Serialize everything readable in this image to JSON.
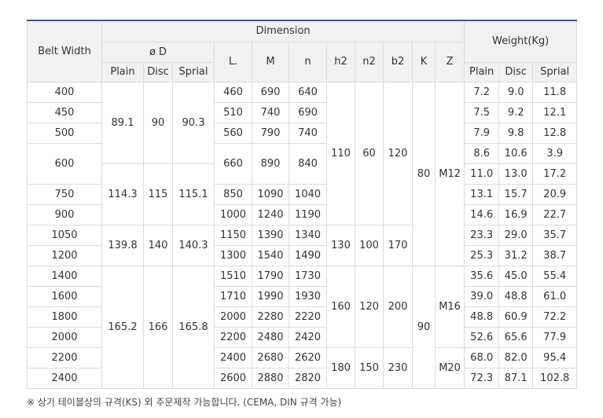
{
  "table": {
    "headers": {
      "belt_width": "Belt Width",
      "dimension": "Dimension",
      "weight": "Weight(Kg)",
      "phi_d": "ø D",
      "l": "L.",
      "m": "M",
      "n": "n",
      "h2": "h2",
      "n2": "n2",
      "b2": "b2",
      "k": "K",
      "z": "Z",
      "plain": "Plain",
      "disc": "Disc",
      "sprial": "Sprial",
      "w_plain": "Plain",
      "w_disc": "Disc",
      "w_sprial": "Sprial"
    },
    "belt_widths": [
      "400",
      "450",
      "500",
      "600",
      "750",
      "900",
      "1050",
      "1200",
      "1400",
      "1600",
      "1800",
      "2000",
      "2200",
      "2400"
    ],
    "phi_d_groups": [
      {
        "plain": "89.1",
        "disc": "90",
        "sprial": "90.3"
      },
      {
        "plain": "114.3",
        "disc": "115",
        "sprial": "115.1"
      },
      {
        "plain": "139.8",
        "disc": "140",
        "sprial": "140.3"
      },
      {
        "plain": "165.2",
        "disc": "166",
        "sprial": "165.8"
      }
    ],
    "lmn": [
      [
        "460",
        "690",
        "640"
      ],
      [
        "510",
        "740",
        "690"
      ],
      [
        "560",
        "790",
        "740"
      ],
      [
        "660",
        "890",
        "840"
      ],
      [
        "850",
        "1090",
        "1040"
      ],
      [
        "1000",
        "1240",
        "1190"
      ],
      [
        "1150",
        "1390",
        "1340"
      ],
      [
        "1300",
        "1540",
        "1490"
      ],
      [
        "1510",
        "1790",
        "1730"
      ],
      [
        "1710",
        "1990",
        "1930"
      ],
      [
        "2000",
        "2280",
        "2220"
      ],
      [
        "2200",
        "2480",
        "2420"
      ],
      [
        "2400",
        "2680",
        "2620"
      ],
      [
        "2600",
        "2880",
        "2820"
      ]
    ],
    "h_groups": [
      {
        "h2": "110",
        "n2": "60",
        "b2": "120"
      },
      {
        "h2": "130",
        "n2": "100",
        "b2": "170"
      },
      {
        "h2": "160",
        "n2": "120",
        "b2": "200"
      },
      {
        "h2": "180",
        "n2": "150",
        "b2": "230"
      }
    ],
    "k_values": [
      "80",
      "90"
    ],
    "z_values": [
      "M12",
      "M16",
      "M20"
    ],
    "weights": [
      [
        "7.2",
        "9.0",
        "11.8"
      ],
      [
        "7.5",
        "9.2",
        "12.1"
      ],
      [
        "7.9",
        "9.8",
        "12.8"
      ],
      [
        "8.6",
        "10.6",
        "3.9"
      ],
      [
        "11.0",
        "13.0",
        "17.2"
      ],
      [
        "13.1",
        "15.7",
        "20.9"
      ],
      [
        "14.6",
        "16.9",
        "22.7"
      ],
      [
        "23.3",
        "29.0",
        "35.7"
      ],
      [
        "25.3",
        "31.2",
        "38.7"
      ],
      [
        "35.6",
        "45.0",
        "55.4"
      ],
      [
        "39.0",
        "48.8",
        "61.0"
      ],
      [
        "48.8",
        "60.9",
        "72.2"
      ],
      [
        "52.6",
        "65.6",
        "77.9"
      ],
      [
        "68.0",
        "82.0",
        "95.4"
      ],
      [
        "72.3",
        "87.1",
        "102.8"
      ]
    ]
  },
  "footnote": "※ 상기 테이블상의 규격(KS) 외 주문제작 가능합니다. (CEMA, DIN 규격 가능)"
}
